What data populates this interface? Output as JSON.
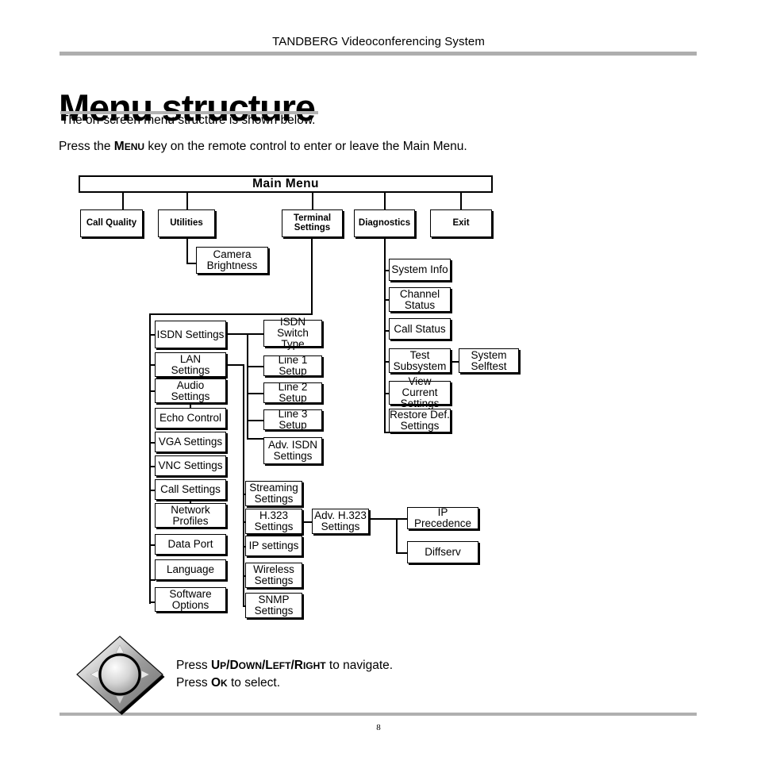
{
  "header": {
    "title": "TANDBERG Videoconferencing System"
  },
  "page": {
    "heading": "Menu structure",
    "intro_line_1": "The on-screen menu structure is shown below.",
    "intro_line_2_before": "Press the ",
    "intro_smallcaps_upper": "M",
    "intro_smallcaps_lower": "ENU",
    "intro_line_2_after": " key on the remote control to enter or leave the Main Menu.",
    "page_number": "8"
  },
  "diagram": {
    "root": "Main Menu",
    "level1": [
      {
        "label": "Call Quality"
      },
      {
        "label": "Utilities"
      },
      {
        "label": "Terminal\nSettings"
      },
      {
        "label": "Diagnostics"
      },
      {
        "label": "Exit"
      }
    ],
    "utilities_children": [
      "Camera\nBrightness"
    ],
    "terminal_settings_children": [
      "ISDN Settings",
      "LAN\nSettings",
      "Audio\nSettings",
      "Echo Control",
      "VGA Settings",
      "VNC Settings",
      "Call Settings",
      "Network\nProfiles",
      "Data Port",
      "Language",
      "Software\nOptions"
    ],
    "isdn_children": [
      "ISDN Switch\nType",
      "Line 1 Setup",
      "Line 2 Setup",
      "Line 3 Setup",
      "Adv. ISDN\nSettings"
    ],
    "lan_children": [
      "Streaming\nSettings",
      "H.323\nSettings",
      "IP settings",
      "Wireless\nSettings",
      "SNMP\nSettings"
    ],
    "h323_children": [
      "Adv. H.323\nSettings"
    ],
    "adv_h323_children": [
      "IP Precedence",
      "Diffserv"
    ],
    "diagnostics_children": [
      "System Info",
      "Channel\nStatus",
      "Call Status",
      "Test\nSubsystem",
      "View Current\nSettings",
      "Restore Def.\nSettings"
    ],
    "test_subsystem_children": [
      "System\nSelftest"
    ]
  },
  "remote": {
    "icon": "dpad-navigation-icon",
    "instruction_1_pre": "Press ",
    "instruction_1_keys": "UP/DOWN/LEFT/RIGHT",
    "instruction_1_post": " to navigate.",
    "instruction_2_pre": "Press ",
    "instruction_2_keys": "OK",
    "instruction_2_post": " to select."
  },
  "colors": {
    "rule": "#aeaeae",
    "line": "#000000",
    "background": "#ffffff"
  }
}
